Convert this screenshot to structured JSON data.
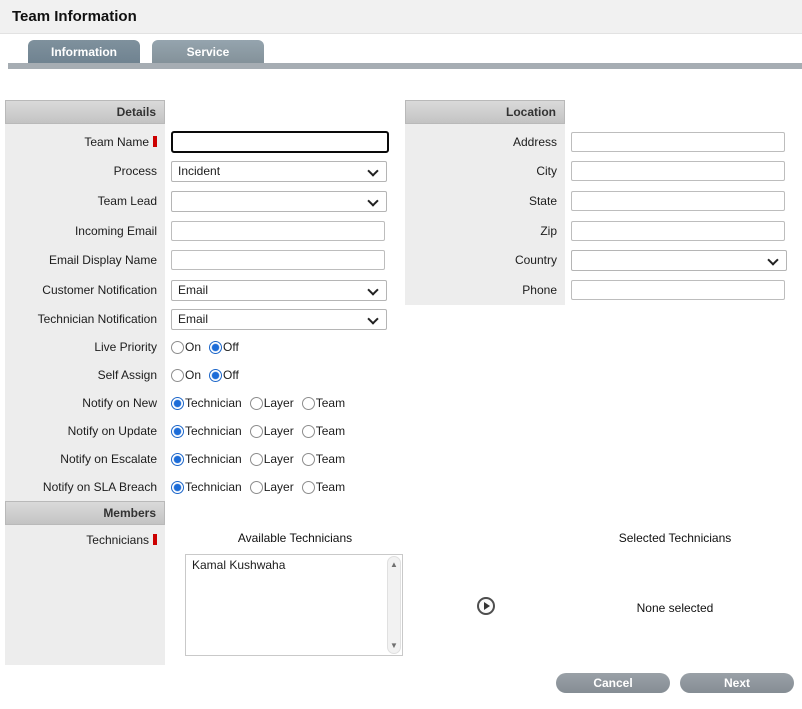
{
  "page": {
    "title": "Team Information"
  },
  "tabs": {
    "information": "Information",
    "service": "Service"
  },
  "details": {
    "header": "Details",
    "team_name_label": "Team Name",
    "process_label": "Process",
    "process_value": "Incident",
    "team_lead_label": "Team Lead",
    "incoming_email_label": "Incoming Email",
    "email_display_name_label": "Email Display Name",
    "customer_notification_label": "Customer Notification",
    "customer_notification_value": "Email",
    "technician_notification_label": "Technician Notification",
    "technician_notification_value": "Email",
    "live_priority_label": "Live Priority",
    "live_priority_value": "Off",
    "self_assign_label": "Self Assign",
    "self_assign_value": "Off",
    "notify_on_new_label": "Notify on New",
    "notify_on_new_value": "Technician",
    "notify_on_update_label": "Notify on Update",
    "notify_on_update_value": "Technician",
    "notify_on_escalate_label": "Notify on Escalate",
    "notify_on_escalate_value": "Technician",
    "notify_on_sla_breach_label": "Notify on SLA Breach",
    "notify_on_sla_breach_value": "Technician",
    "on_label": "On",
    "off_label": "Off",
    "technician_label": "Technician",
    "layer_label": "Layer",
    "team_label": "Team"
  },
  "location": {
    "header": "Location",
    "address_label": "Address",
    "city_label": "City",
    "state_label": "State",
    "zip_label": "Zip",
    "country_label": "Country",
    "phone_label": "Phone"
  },
  "members": {
    "header": "Members",
    "technicians_label": "Technicians",
    "available_title": "Available Technicians",
    "selected_title": "Selected Technicians",
    "available_technicians": [
      "Kamal Kushwaha"
    ],
    "selected_empty_text": "None selected"
  },
  "actions": {
    "cancel_label": "Cancel",
    "next_label": "Next"
  },
  "colors": {
    "radio_selected": "#1c6cd8",
    "required_marker": "#cc0000",
    "tab_background": "#7f919d",
    "section_header_top": "#dadada",
    "section_header_bottom": "#c3c3c3",
    "button_background": "#8e969d"
  }
}
